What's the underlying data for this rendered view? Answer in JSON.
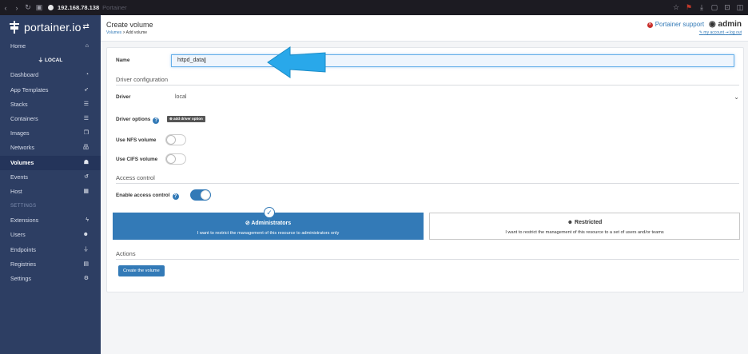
{
  "browser": {
    "url": "192.168.78.138",
    "tab_title": "Portainer"
  },
  "sidebar": {
    "logo": "portainer.io",
    "endpoint_label": "LOCAL",
    "settings_heading": "SETTINGS",
    "items": [
      {
        "label": "Home",
        "icon": "home-icon",
        "glyph": "⌂"
      },
      {
        "label": "Dashboard",
        "icon": "dashboard-icon",
        "glyph": "◔"
      },
      {
        "label": "App Templates",
        "icon": "rocket-icon",
        "glyph": "➶"
      },
      {
        "label": "Stacks",
        "icon": "list-icon",
        "glyph": "☰"
      },
      {
        "label": "Containers",
        "icon": "server-icon",
        "glyph": "☰"
      },
      {
        "label": "Images",
        "icon": "clone-icon",
        "glyph": "❐"
      },
      {
        "label": "Networks",
        "icon": "sitemap-icon",
        "glyph": "品"
      },
      {
        "label": "Volumes",
        "icon": "cubes-icon",
        "glyph": "☗"
      },
      {
        "label": "Events",
        "icon": "history-icon",
        "glyph": "↺"
      },
      {
        "label": "Host",
        "icon": "th-icon",
        "glyph": "▦"
      }
    ],
    "settings_items": [
      {
        "label": "Extensions",
        "icon": "bolt-icon",
        "glyph": "ϟ"
      },
      {
        "label": "Users",
        "icon": "users-icon",
        "glyph": "☻"
      },
      {
        "label": "Endpoints",
        "icon": "plug-icon",
        "glyph": "⏚"
      },
      {
        "label": "Registries",
        "icon": "database-icon",
        "glyph": "▤"
      },
      {
        "label": "Settings",
        "icon": "cogs-icon",
        "glyph": "⚙"
      }
    ]
  },
  "header": {
    "title": "Create volume",
    "breadcrumb_parent": "Volumes",
    "breadcrumb_sep": " > ",
    "breadcrumb_current": "Add volume",
    "support_label": "Portainer support",
    "user": "admin",
    "my_account": "my account",
    "log_out": "log out"
  },
  "form": {
    "name_label": "Name",
    "name_value": "httpd_data",
    "driver_config_title": "Driver configuration",
    "driver_label": "Driver",
    "driver_value": "local",
    "driver_options_label": "Driver options",
    "add_driver_option": "add driver option",
    "nfs_label": "Use NFS volume",
    "cifs_label": "Use CIFS volume",
    "access_control_title": "Access control",
    "enable_ac_label": "Enable access control",
    "admins_title": "Administrators",
    "admins_desc": "I want to restrict the management of this resource to administrators only",
    "restricted_title": "Restricted",
    "restricted_desc": "I want to restrict the management of this resource to a set of users and/or teams",
    "actions_title": "Actions",
    "create_button": "Create the volume"
  },
  "state": {
    "nfs_enabled": false,
    "cifs_enabled": false,
    "access_control_enabled": true,
    "selected_ac_option": "Administrators"
  },
  "colors": {
    "sidebar_bg": "#2d3e63",
    "primary": "#337ab7",
    "annotation_arrow": "#29a8ea"
  }
}
